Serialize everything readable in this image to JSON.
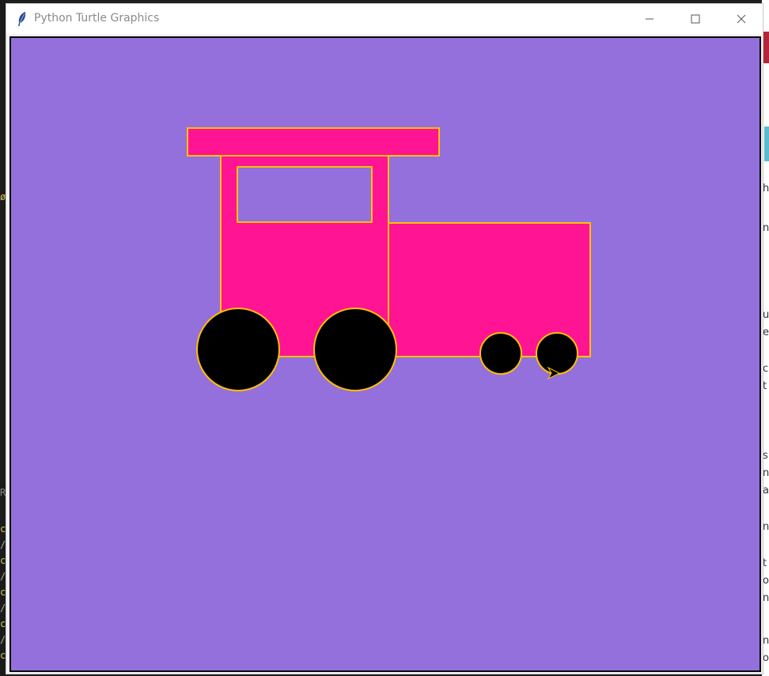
{
  "window": {
    "title": "Python Turtle Graphics",
    "icon": "feather-icon",
    "controls": {
      "minimize": "minimize-icon",
      "maximize": "maximize-icon",
      "close": "close-icon"
    }
  },
  "canvas": {
    "background_color": "#9370db",
    "drawing": {
      "body_fill": "#ff1493",
      "outline": "#ffc000",
      "wheel_fill": "#000000",
      "window_fill": "#9370db",
      "turtle_cursor": "arrow-cursor-icon"
    }
  }
}
